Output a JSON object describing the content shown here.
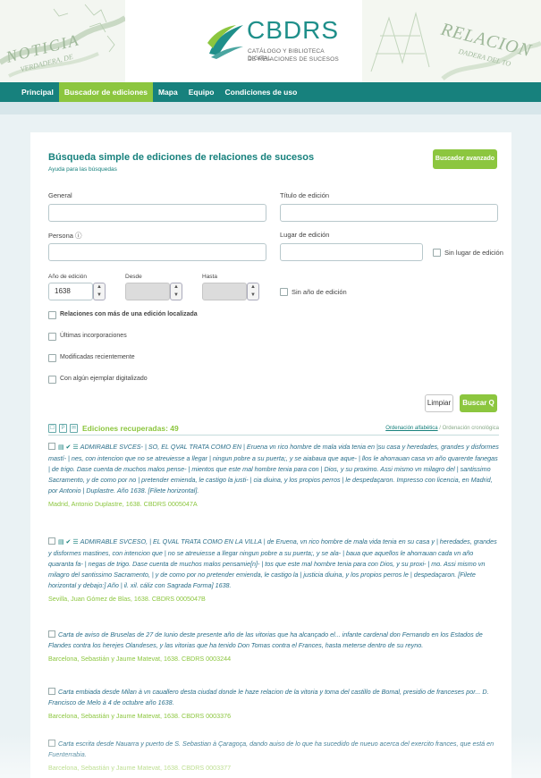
{
  "banner": {
    "logo_title": "CBDRS",
    "logo_sub": [
      "CATÁLOGO Y BIBLIOTECA DIGITAL",
      "DE RELACIONES DE SUCESOS"
    ],
    "deco_left": [
      "NOTICIA",
      "VERDADERA, DE"
    ],
    "deco_right": [
      "RELACION",
      "DADERA DEL TO"
    ]
  },
  "nav": {
    "items": [
      "Principal",
      "Buscador de ediciones",
      "Mapa",
      "Equipo",
      "Condiciones de uso"
    ],
    "active_index": 1
  },
  "search": {
    "title": "Búsqueda simple de ediciones de relaciones de sucesos",
    "help": "Ayuda para las búsquedas",
    "advanced_button": "Buscador avanzado",
    "general_label": "General",
    "general_value": "",
    "title_label": "Título de edición",
    "title_value": "",
    "person_label": "Persona ⓘ",
    "person_value": "",
    "place_label": "Lugar de edición",
    "place_value": "",
    "no_place_label": "Sin lugar de edición",
    "year_label": "Año de edición",
    "year_value": "1638",
    "from_label": "Desde",
    "to_label": "Hasta",
    "no_year_label": "Sin año de edición",
    "multi_label": "Relaciones con más de una edición localizada",
    "latest_label": "Últimas incorporaciones",
    "modified_label": "Modificadas recientemente",
    "digitized_label": "Con algún ejemplar digitalizado",
    "clear_button": "Limpiar",
    "search_button": "Buscar Q"
  },
  "results": {
    "title": "Ediciones recuperadas: 49",
    "sort_alpha": "Ordenación alfabética",
    "sort_sep": " / ",
    "sort_chrono": "Ordenación cronológica",
    "items": [
      {
        "icons": "▤ ✔ ☰",
        "text": "ADMIRABLE SVCES- | SO, EL QVAL TRATA COMO EN | Eruena vn rico hombre de mala vida tenia en |su casa y heredades, grandes y disformes mastí- | nes, con intencion que no se atreuiesse a llegar | ningun pobre a su puerta;, y se aiabaua que aque- | llos le ahorrauan casa vn año quarente fanegas | de trigo. Dase cuenta de muchos malos pense- | mientos que este mal hombre tenia para con | Dios, y su proximo. Assi mismo vn milagro del | santissimo Sacramento, y de como por no | pretender emienda, le castigo la justi- | cia diuina, y los propios perros | le despedaçaron. Impresso con licencia, en Madrid, por Antonio | Duplastre. Año 1638. [Filete horizontal].",
        "meta": "Madrid, Antonio Duplastre, 1638. CBDRS 0005047A"
      },
      {
        "icons": "▤ ✔ ☰",
        "text": "ADMIRABLE SVCESO, | EL QVAL TRATA COMO EN LA VILLA | de Eruena, vn rico hombre de mala vida tenia en su casa y | heredades, grandes y disformes mastines, con intencion que | no se atreuiesse a llegar ningun pobre a su puerta;, y se ala- | baua que aquellos le ahorrauan cada vn año quaranta fa- | negas de trigo. Dase cuenta de muchos malos pensamie[n]- | tos que este mal hombre tenia para con Dios, y su proxi- | mo. Assi mismo vn milagro del santissimo Sacramento, | y de como por no pretender emienda, le castigo la | justicia diuina, y los propios perros le | despedaçaron. [Filete horizontal y debajo:] Año | il. xil. cáliz con Sagrada Forma] 1638.",
        "meta": "Sevilla, Juan Gómez de Blas, 1638. CBDRS 0005047B"
      },
      {
        "icons": "",
        "text": "Carta de aviso de Bruselas de 27 de Iunio deste presente año de las vitorias que ha alcançado el... infante cardenal don Fernando en los Estados de Flandes contra los herejes Olandeses, y las vitorias que ha tenido Don Tomas contra el Frances, hasta meterse dentro de su reyno.",
        "meta": "Barcelona, Sebastián y Jaume Matevat, 1638. CBDRS 0003244"
      },
      {
        "icons": "",
        "text": "Carta embiada desde Milan à vn cauallero desta ciudad donde le haze relacion de la vitoria y toma del castillo de Bomal, presidio de franceses por... D. Francisco de Melo à 4 de octubre año 1638.",
        "meta": "Barcelona, Sebastián y Jaume Matevat, 1638. CBDRS 0003376"
      },
      {
        "icons": "",
        "text": "Carta escrita desde Nauarra y puerto de S. Sebastian à Çaragoça, dando auiso de lo que ha sucedido de nueuo acerca del exercito frances, que está en Fuenterrabia.",
        "meta": "Barcelona, Sebastián y Jaume Matevat, 1638. CBDRS 0003377"
      }
    ]
  }
}
